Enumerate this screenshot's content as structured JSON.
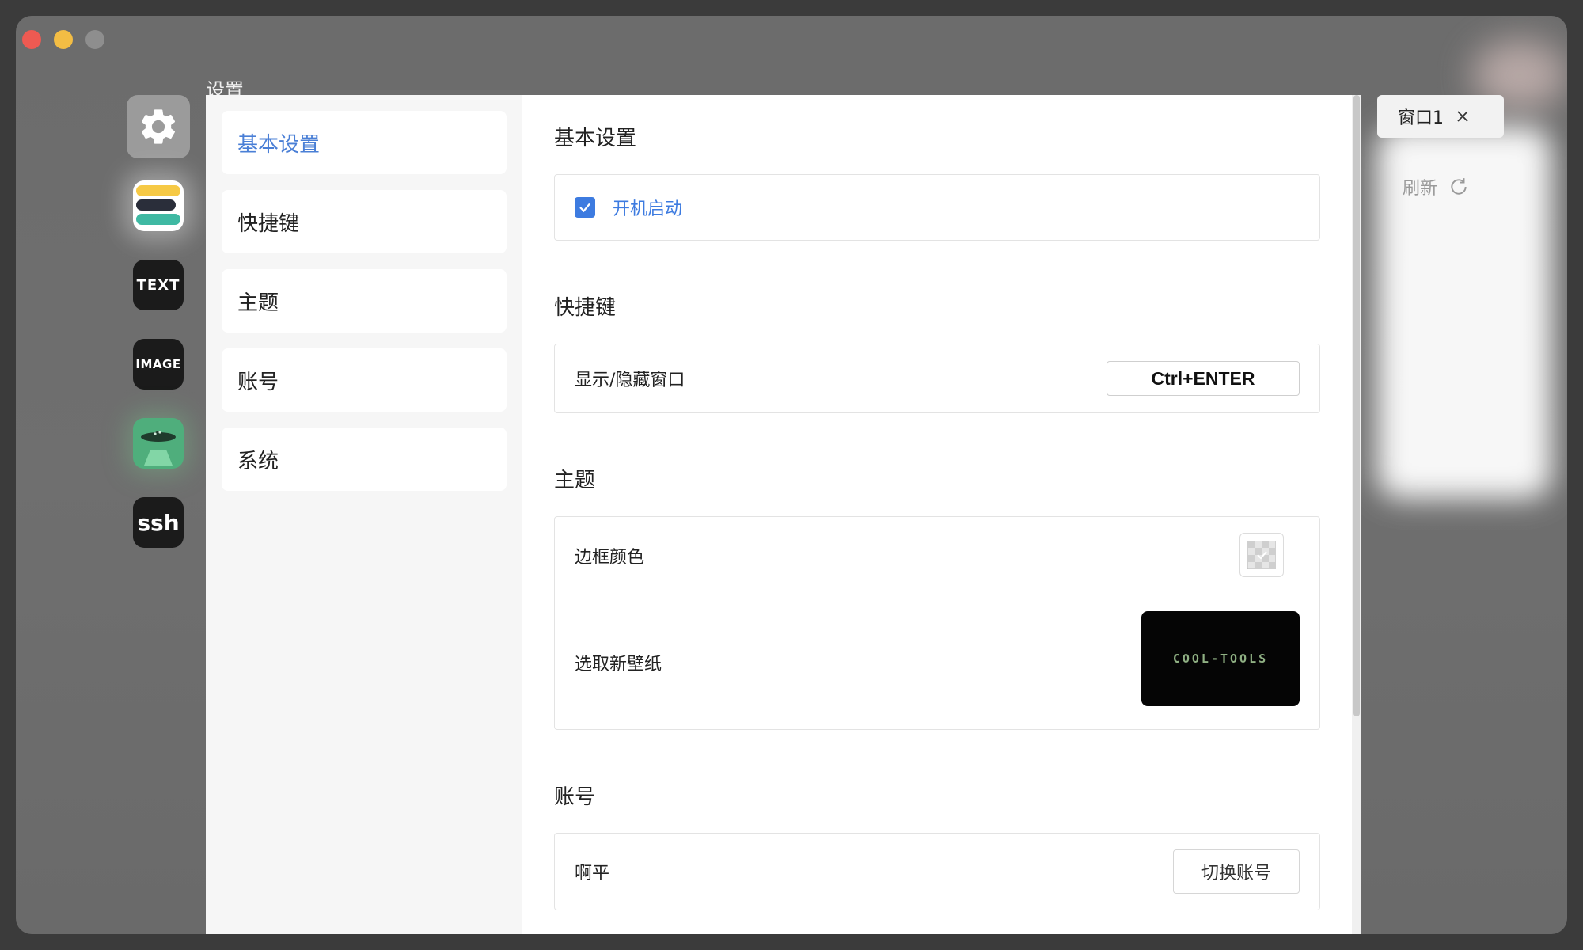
{
  "window": {
    "title": "设置"
  },
  "dock": {
    "text_app_label": "TEXT",
    "image_app_label": "IMAGE",
    "ssh_app_label": "ssh"
  },
  "menu": {
    "items": [
      {
        "label": "基本设置",
        "active": true
      },
      {
        "label": "快捷键"
      },
      {
        "label": "主题"
      },
      {
        "label": "账号"
      },
      {
        "label": "系统"
      }
    ]
  },
  "sections": {
    "basic": {
      "title": "基本设置",
      "autostart_label": "开机启动",
      "autostart_checked": true
    },
    "hotkeys": {
      "title": "快捷键",
      "toggle_window_label": "显示/隐藏窗口",
      "toggle_window_key": "Ctrl+ENTER"
    },
    "theme": {
      "title": "主题",
      "border_color_label": "边框颜色",
      "wallpaper_label": "选取新壁纸",
      "wallpaper_preview_text": "COOL-TOOLS"
    },
    "account": {
      "title": "账号",
      "username": "啊平",
      "switch_button": "切换账号"
    }
  },
  "sidebar_right": {
    "tab_label": "窗口1",
    "refresh_label": "刷新"
  },
  "colors": {
    "accent": "#3d7be0",
    "menu_active": "#4a7fd6",
    "ufo_app": "#4fae7c"
  }
}
